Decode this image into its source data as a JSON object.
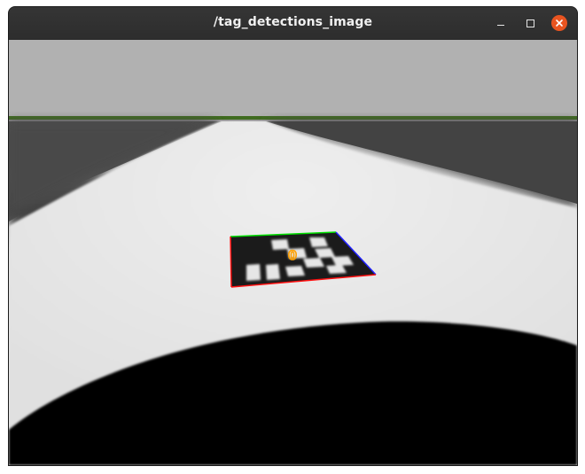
{
  "window": {
    "title": "/tag_detections_image"
  },
  "titlebar_buttons": {
    "minimize": "minimize",
    "maximize": "maximize",
    "close": "close"
  },
  "image_view": {
    "tag_id_label": "0",
    "colors": {
      "sky": "#b1b1b1",
      "grass": "#3f6b1f",
      "road": "#e3e3e3",
      "shoulder": "#4a4a4a",
      "tag_black": "#1b1b1b",
      "tag_white": "#e6e6e6",
      "edge_green": "#00e000",
      "edge_blue": "#2020ff",
      "edge_red": "#ff1010",
      "id_label": "#ffa000"
    }
  }
}
